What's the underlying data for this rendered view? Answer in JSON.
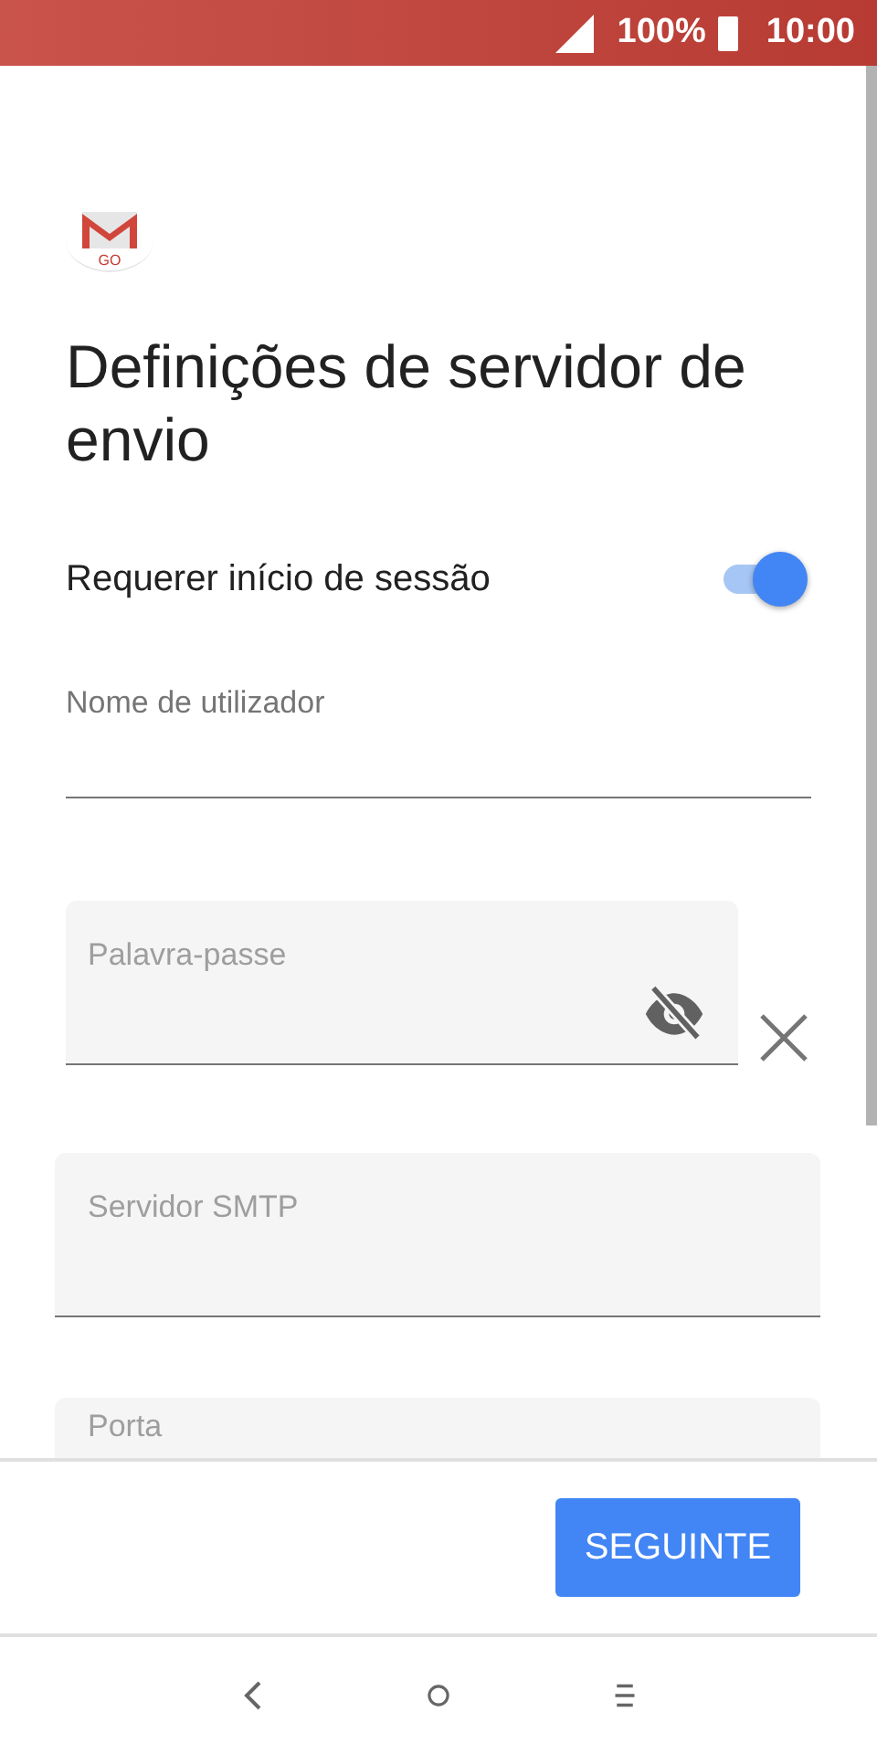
{
  "status_bar": {
    "battery": "100%",
    "time": "10:00"
  },
  "logo": {
    "text": "GO"
  },
  "title": "Definições de servidor de envio",
  "toggle": {
    "label": "Requerer início de sessão",
    "on": true
  },
  "fields": [
    {
      "kind": "plain",
      "label": "Nome de utilizador"
    },
    {
      "kind": "password",
      "placeholder": "Palavra-passe"
    },
    {
      "kind": "filled",
      "placeholder": "Servidor SMTP"
    },
    {
      "kind": "filled",
      "placeholder": "Porta"
    }
  ],
  "footer": {
    "button": "SEGUINTE"
  }
}
